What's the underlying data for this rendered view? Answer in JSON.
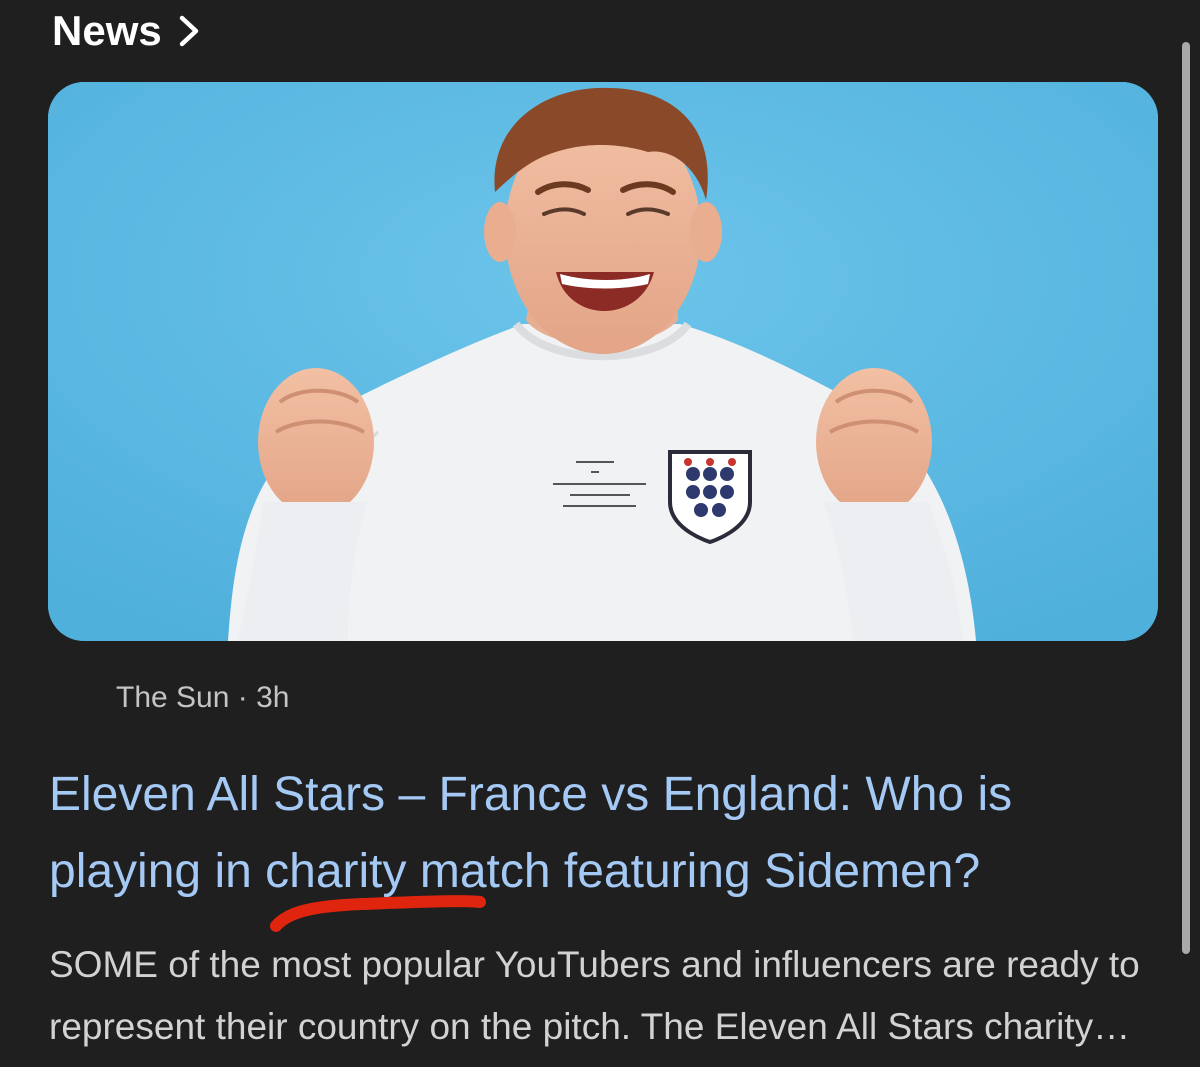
{
  "section": {
    "title": "News"
  },
  "article": {
    "image_alt": "Smiling young man in a white England sweatshirt with fists raised against a blue background",
    "source": "The Sun",
    "age": "3h",
    "headline": "Eleven All Stars – France vs England: Who is playing in charity match featuring Sidemen?",
    "snippet": "SOME of the most popular YouTubers and influencers are ready to represent their country on the pitch. The Eleven All Stars charity match"
  },
  "colors": {
    "background": "#1f1f1f",
    "headline": "#a5c9f5",
    "annotation": "#e0250f",
    "photo_backdrop": "#5db9e1"
  },
  "icons": {
    "header_chevron": "chevron-right-icon"
  }
}
